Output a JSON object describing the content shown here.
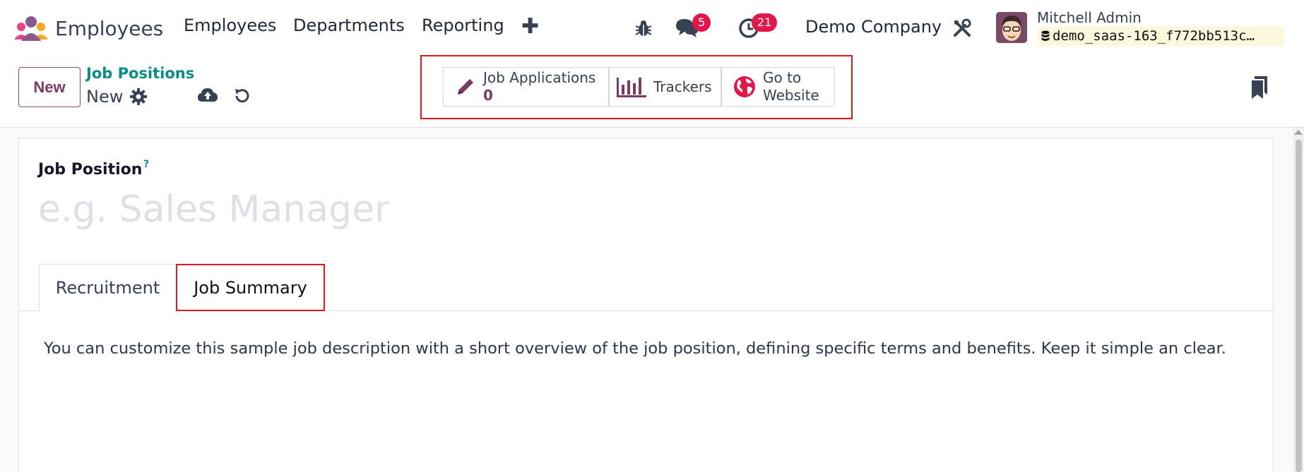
{
  "navbar": {
    "app_name": "Employees",
    "menu": [
      "Employees",
      "Departments",
      "Reporting"
    ],
    "messages_count": "5",
    "activities_count": "21",
    "company": "Demo Company",
    "user_name": "Mitchell Admin",
    "database": "demo_saas-163_f772bb513c…"
  },
  "control_panel": {
    "new_label": "New",
    "breadcrumb_parent": "Job Positions",
    "breadcrumb_current": "New"
  },
  "smart_buttons": {
    "job_applications_label": "Job Applications",
    "job_applications_value": "0",
    "trackers_label": "Trackers",
    "website_line1": "Go to",
    "website_line2": "Website"
  },
  "form": {
    "field_label": "Job Position",
    "help_mark": "?",
    "name_placeholder": "e.g. Sales Manager",
    "name_value": "",
    "tabs": [
      "Recruitment",
      "Job Summary"
    ],
    "active_tab": "Job Summary",
    "description": "You can customize this sample job description with a short overview of the job position, defining specific terms and benefits. Keep it simple an clear."
  },
  "colors": {
    "brand": "#7a3b63",
    "link": "#0b8b83",
    "badge": "#e0174a",
    "highlight": "#e0181e"
  },
  "icons": [
    "app-logo-icon",
    "plus-icon",
    "bug-icon",
    "chat-icon",
    "clock-icon",
    "tools-icon",
    "database-icon",
    "gear-icon",
    "cloud-upload-icon",
    "undo-icon",
    "pencil-icon",
    "bar-chart-icon",
    "globe-icon",
    "bookmark-icon"
  ]
}
